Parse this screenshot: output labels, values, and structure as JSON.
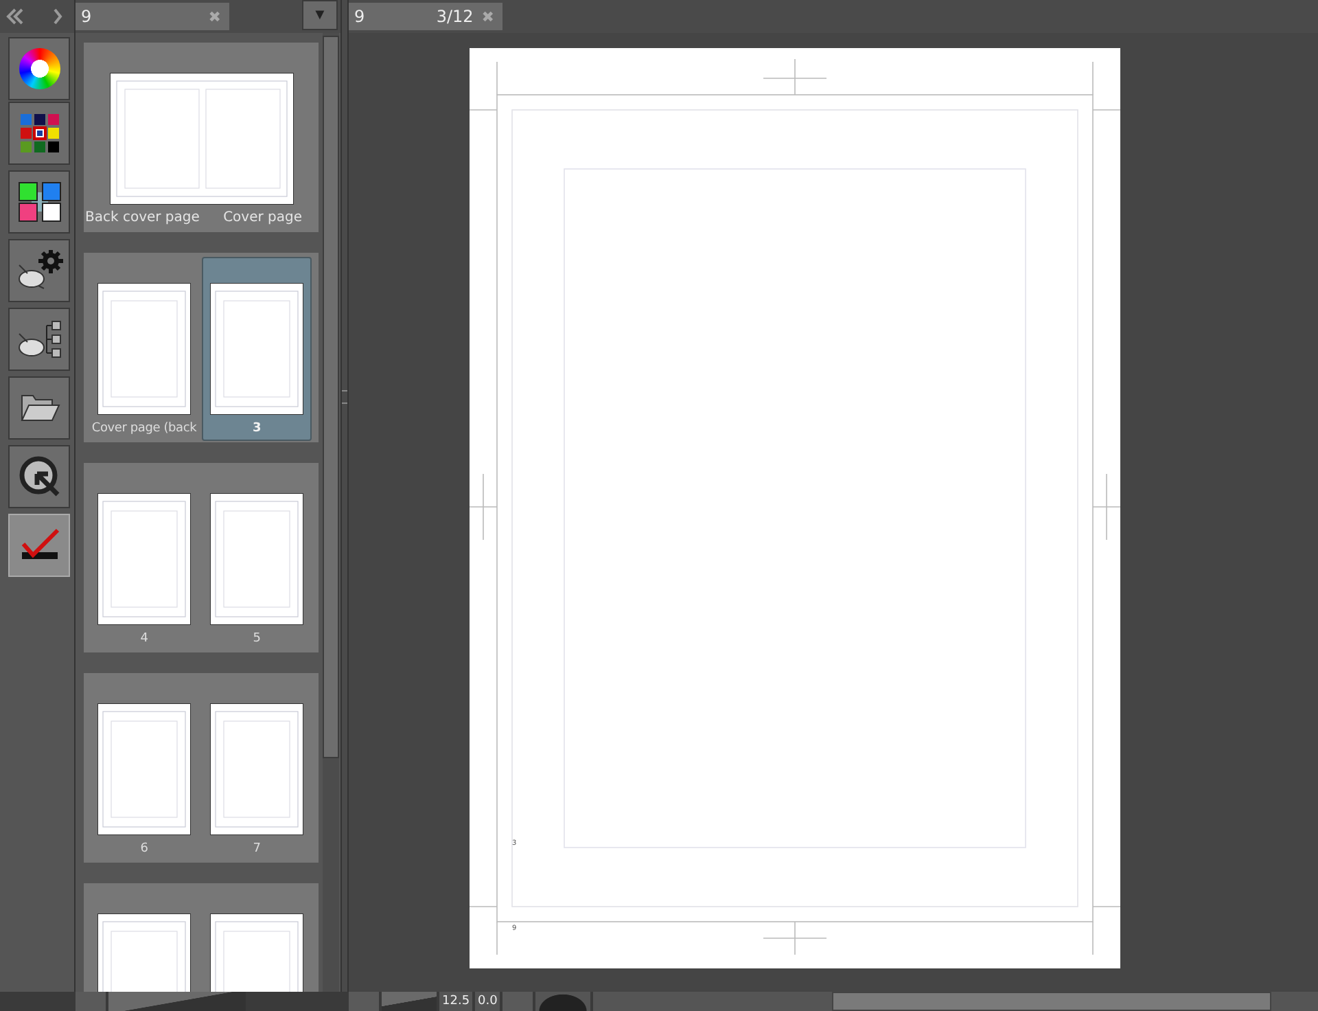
{
  "tools": [
    {
      "kind": "color-wheel",
      "selected": false
    },
    {
      "kind": "color-set",
      "selected": false
    },
    {
      "kind": "color-mix",
      "selected": false
    },
    {
      "kind": "gear",
      "selected": false
    },
    {
      "kind": "tree",
      "selected": false
    },
    {
      "kind": "folder",
      "selected": false
    },
    {
      "kind": "navigator",
      "selected": false
    },
    {
      "kind": "check",
      "selected": true
    }
  ],
  "page_panel": {
    "tab_label": "9",
    "tab_close": "✖",
    "menu_glyph": "▼",
    "spreads": [
      {
        "kind": "wide",
        "labels": [
          "Back cover page",
          "Cover page"
        ]
      },
      {
        "kind": "pair",
        "pages": [
          {
            "label": "Cover page (back",
            "selected": false
          },
          {
            "label": "3",
            "selected": true
          }
        ]
      },
      {
        "kind": "pair",
        "pages": [
          {
            "label": "4",
            "selected": false
          },
          {
            "label": "5",
            "selected": false
          }
        ]
      },
      {
        "kind": "pair",
        "pages": [
          {
            "label": "6",
            "selected": false
          },
          {
            "label": "7",
            "selected": false
          }
        ]
      },
      {
        "kind": "pair",
        "pages": [
          {
            "selected": false
          },
          {
            "selected": false
          }
        ]
      }
    ]
  },
  "canvas": {
    "tab_label": "9",
    "tab_page": "3/12",
    "tab_close": "✖",
    "page_number": "3",
    "sheet_label": "9"
  },
  "status_bar": {
    "zoom": "12.5",
    "angle": "0.0"
  }
}
